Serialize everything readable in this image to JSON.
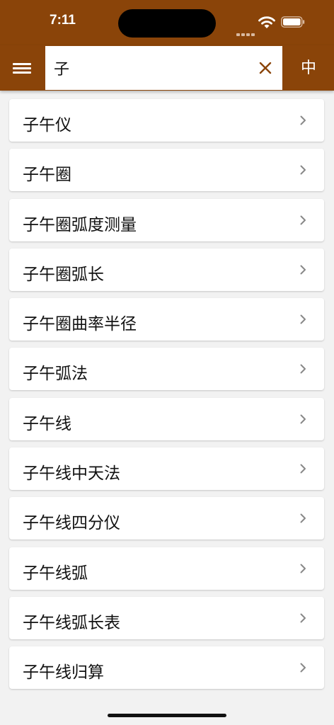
{
  "status": {
    "time": "7:11"
  },
  "app_bar": {
    "menu_icon": "hamburger-menu-icon",
    "search": {
      "value": "子",
      "placeholder": ""
    },
    "clear_icon": "close-icon",
    "language_toggle": "中"
  },
  "colors": {
    "brand": "#8a4409",
    "background": "#f2f2f2",
    "card": "#ffffff",
    "chevron": "#888888"
  },
  "results": [
    {
      "label": "子午仪"
    },
    {
      "label": "子午圈"
    },
    {
      "label": "子午圈弧度测量"
    },
    {
      "label": "子午圈弧长"
    },
    {
      "label": "子午圈曲率半径"
    },
    {
      "label": "子午弧法"
    },
    {
      "label": "子午线"
    },
    {
      "label": "子午线中天法"
    },
    {
      "label": "子午线四分仪"
    },
    {
      "label": "子午线弧"
    },
    {
      "label": "子午线弧长表"
    },
    {
      "label": "子午线归算"
    }
  ]
}
